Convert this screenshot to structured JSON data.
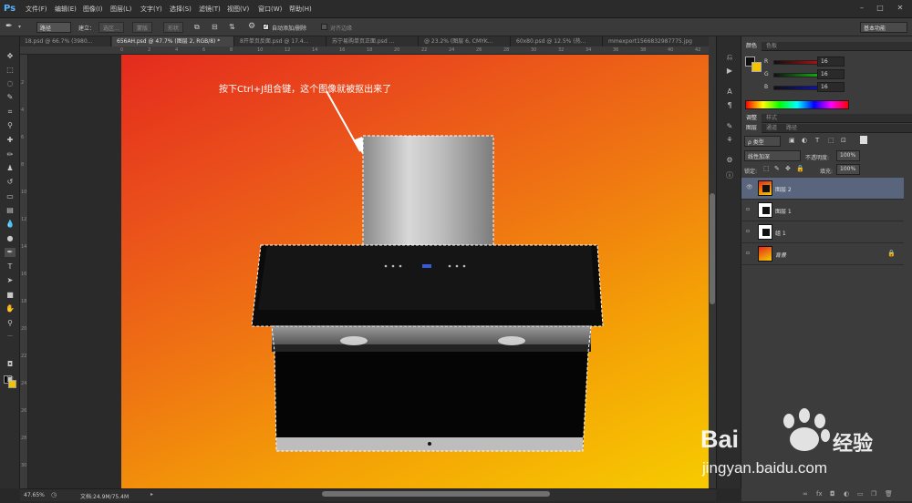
{
  "app": {
    "logo": "Ps"
  },
  "menubar": {
    "items": [
      "文件(F)",
      "编辑(E)",
      "图像(I)",
      "图层(L)",
      "文字(Y)",
      "选择(S)",
      "滤镜(T)",
      "视图(V)",
      "窗口(W)",
      "帮助(H)"
    ],
    "window_controls": [
      "–",
      "□",
      "✕"
    ]
  },
  "options": {
    "mode": "路径",
    "build_label": "建立：",
    "selection_btn": "选区…",
    "mask_btn": "蒙版",
    "shape_btn": "形状",
    "auto_add_delete": "自动添加/删除",
    "align_edges": "对齐边缘",
    "workspace": "基本功能"
  },
  "tabs": [
    "18.psd @ 66.7% (3980...",
    "656AH.psd @ 47.7% (图层 2, RGB/8) *",
    "8开单页反面.psd @ 17.4...",
    "苏宁易购单页正面.psd ...",
    "@ 23.2% (图层 6, CMYK...",
    "60x80.psd @ 12.5% (热...",
    "mmexport1566832987775.jpg"
  ],
  "tab_close": "×",
  "ruler": {
    "top": [
      "0",
      "2",
      "4",
      "6",
      "8",
      "10",
      "12",
      "14",
      "16",
      "18",
      "20",
      "22",
      "24",
      "26",
      "28",
      "30",
      "32",
      "34",
      "36",
      "38",
      "40",
      "42",
      "44"
    ],
    "left": [
      "2",
      "4",
      "6",
      "8",
      "10",
      "12",
      "14",
      "16",
      "18",
      "20",
      "22",
      "24",
      "26",
      "28",
      "30",
      "32"
    ]
  },
  "canvas": {
    "annotation": "按下Ctrl+J组合键，这个图像就被抠出来了"
  },
  "status": {
    "zoom": "47.65%",
    "doc": "文档:24.9M/75.4M"
  },
  "colors_panel": {
    "tabs": [
      "颜色",
      "色板"
    ],
    "channels": [
      {
        "label": "R",
        "value": "16"
      },
      {
        "label": "G",
        "value": "16"
      },
      {
        "label": "B",
        "value": "16"
      }
    ]
  },
  "adjust_tabs": [
    "调整",
    "样式"
  ],
  "layers_panel": {
    "tabs": [
      "图层",
      "通道",
      "路径"
    ],
    "filter": "ρ 类型",
    "blend_mode": "线性加深",
    "opacity_label": "不透明度:",
    "opacity": "100%",
    "lock_label": "锁定:",
    "fill_label": "填充:",
    "fill": "100%",
    "layers": [
      {
        "name": "图层 2",
        "selected": true,
        "visible": true
      },
      {
        "name": "图层 1",
        "selected": false,
        "visible": false
      },
      {
        "name": "组 1",
        "selected": false,
        "visible": false
      },
      {
        "name": "背景",
        "selected": false,
        "visible": false,
        "locked": true
      }
    ]
  },
  "watermark": {
    "brand": "Bai",
    "brand2": "经验",
    "url": "jingyan.baidu.com"
  },
  "colors": {
    "fg": "#000000",
    "bg": "#f5c400",
    "selection": "#58657d",
    "accent": "#57b1ff"
  }
}
